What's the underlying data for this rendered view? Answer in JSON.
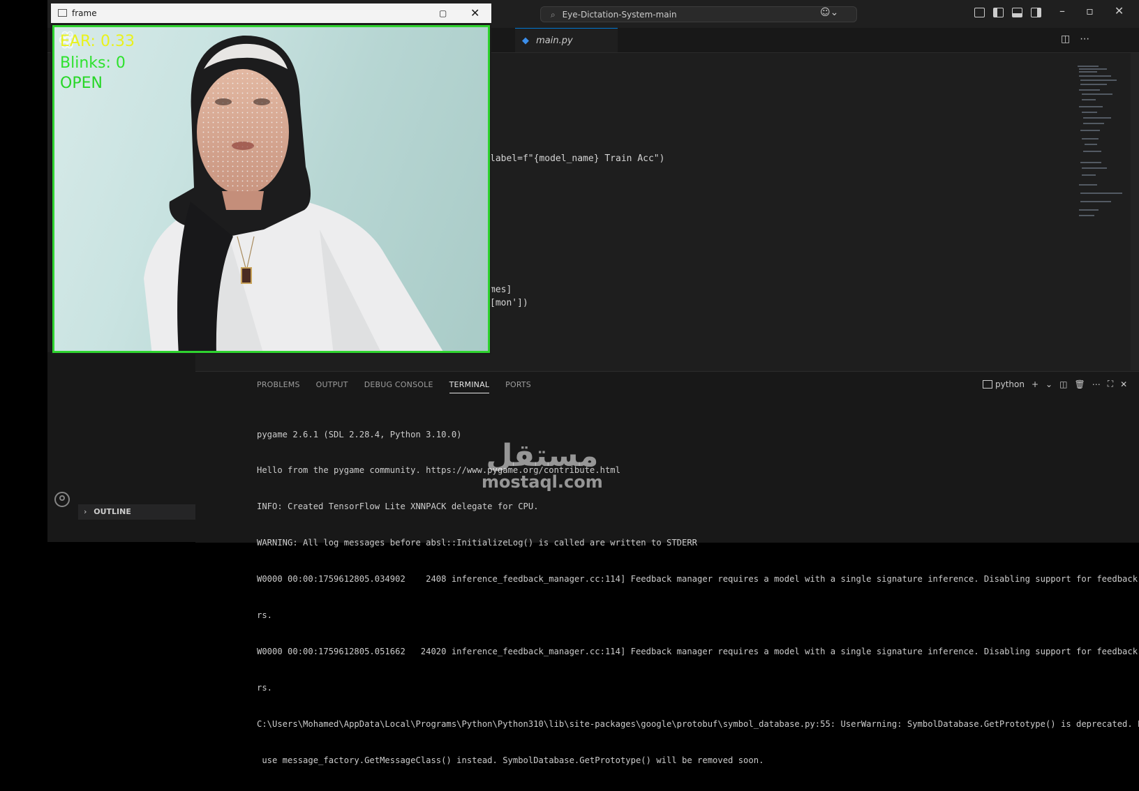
{
  "titlebar": {
    "search_text": "Eye-Dictation-System-main",
    "window_controls": [
      "–",
      "▫",
      "✕"
    ]
  },
  "editor": {
    "tab_label": "main.py",
    "code_lines": [
      "label=f\"{model_name} Train Acc\")",
      "mes]",
      "[mon'])"
    ]
  },
  "sidebar": {
    "outline_label": "OUTLINE"
  },
  "panel": {
    "tabs": [
      "PROBLEMS",
      "OUTPUT",
      "DEBUG CONSOLE",
      "TERMINAL",
      "PORTS"
    ],
    "active_tab": "TERMINAL",
    "terminal_name": "python",
    "terminal_lines": [
      "pygame 2.6.1 (SDL 2.28.4, Python 3.10.0)",
      "Hello from the pygame community. https://www.pygame.org/contribute.html",
      "INFO: Created TensorFlow Lite XNNPACK delegate for CPU.",
      "WARNING: All log messages before absl::InitializeLog() is called are written to STDERR",
      "W0000 00:00:1759612805.034902    2408 inference_feedback_manager.cc:114] Feedback manager requires a model with a single signature inference. Disabling support for feedback tenso",
      "rs.",
      "W0000 00:00:1759612805.051662   24020 inference_feedback_manager.cc:114] Feedback manager requires a model with a single signature inference. Disabling support for feedback tenso",
      "rs.",
      "C:\\Users\\Mohamed\\AppData\\Local\\Programs\\Python\\Python310\\lib\\site-packages\\google\\protobuf\\symbol_database.py:55: UserWarning: SymbolDatabase.GetPrototype() is deprecated. Please",
      " use message_factory.GetMessageClass() instead. SymbolDatabase.GetPrototype() will be removed soon."
    ]
  },
  "frame_window": {
    "title": "frame",
    "ear_text": "EAR: 0.33",
    "blinks_text": "Blinks: 0",
    "state_text": "OPEN"
  },
  "watermark": {
    "arabic": "مستقل",
    "latin": "mostaql.com"
  },
  "colors": {
    "hud_ear": "#e9f21b",
    "hud_green": "#2ee22e",
    "frame_border": "#2fd32f",
    "accent": "#0078d4"
  }
}
